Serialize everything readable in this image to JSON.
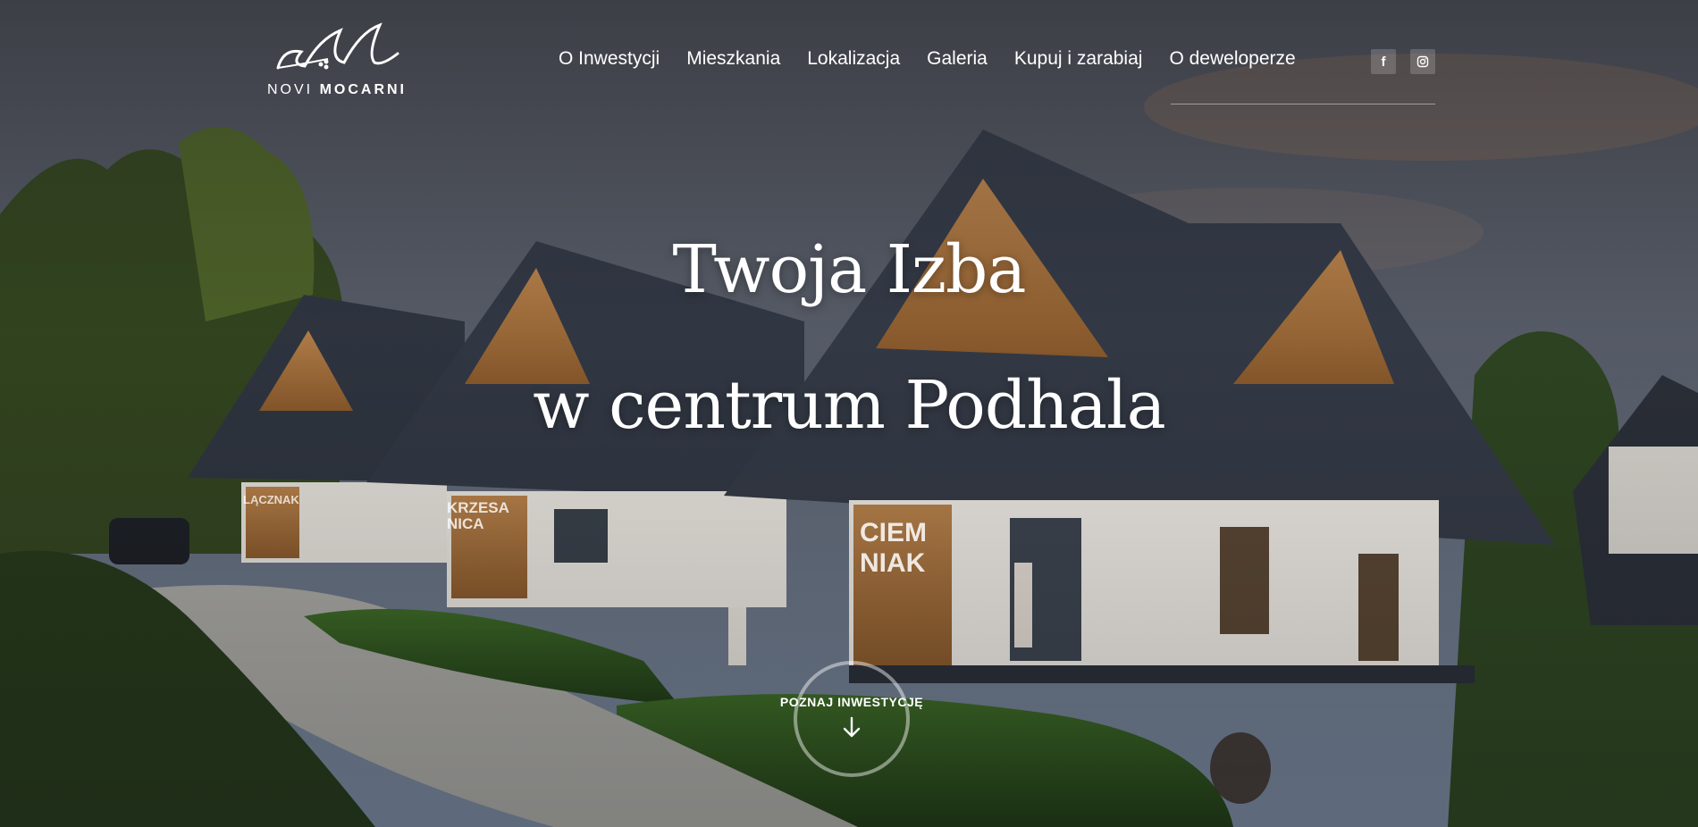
{
  "brand": {
    "word_part1": "NOVI ",
    "word_part2": "MOCARNI"
  },
  "nav": {
    "items": [
      {
        "label": "O Inwestycji"
      },
      {
        "label": "Mieszkania"
      },
      {
        "label": "Lokalizacja"
      },
      {
        "label": "Galeria"
      },
      {
        "label": "Kupuj i zarabiaj"
      },
      {
        "label": "O deweloperze"
      }
    ]
  },
  "social": [
    {
      "icon": "facebook-icon",
      "glyph": "f"
    },
    {
      "icon": "instagram-icon"
    }
  ],
  "hero": {
    "line1": "Twoja Izba",
    "line2": "w centrum Podhala",
    "house_signs": [
      "LĄCZNAK",
      "KRZESANICA",
      "CIEMNIAK"
    ]
  },
  "cta": {
    "label": "POZNAJ INWESTYCJĘ"
  }
}
